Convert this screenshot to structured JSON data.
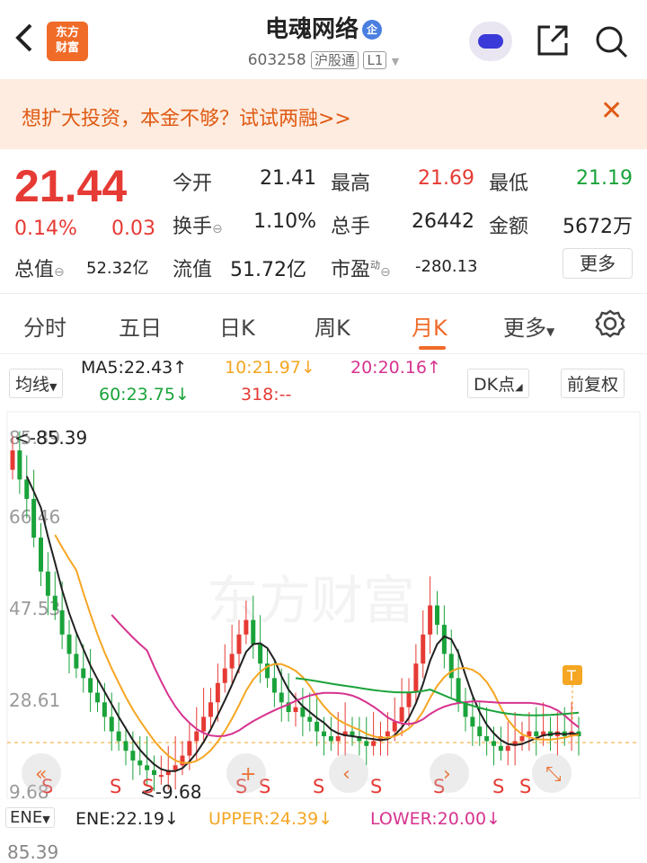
{
  "header": {
    "back_icon": "chevron-left-icon",
    "logo_text_line1": "东方",
    "logo_text_line2": "财富",
    "stock_name": "电魂网络",
    "badge": "企",
    "code": "603258",
    "market_tag": "沪股通",
    "level_tag": "L1"
  },
  "banner": {
    "text": "想扩大投资，本金不够？试试两融>>",
    "close": "✕"
  },
  "quote": {
    "price": "21.44",
    "change_pct": "0.14%",
    "change": "0.03",
    "open_label": "今开",
    "open": "21.41",
    "high_label": "最高",
    "high": "21.69",
    "low_label": "最低",
    "low": "21.19",
    "turnover_label": "换手",
    "turnover": "1.10%",
    "volume_label": "总手",
    "volume": "26442",
    "amount_label": "金额",
    "amount": "5672万",
    "mktcap_label": "总值",
    "mktcap": "52.32亿",
    "float_label": "流值",
    "float_cap": "51.72亿",
    "pe_label": "市盈",
    "pe_sup": "动",
    "pe": "-280.13",
    "more": "更多"
  },
  "tabs": [
    {
      "label": "分时"
    },
    {
      "label": "五日"
    },
    {
      "label": "日K"
    },
    {
      "label": "周K"
    },
    {
      "label": "月K"
    },
    {
      "label": "更多"
    }
  ],
  "ma": {
    "selector": "均线",
    "ma5": "MA5:22.43",
    "ma10": "10:21.97",
    "ma20": "20:20.16",
    "ma60": "60:23.75",
    "ma318": "318:--",
    "dk": "DK点",
    "adjust": "前复权"
  },
  "chart_data": {
    "type": "candlestick",
    "y_ticks": [
      "85.39",
      "66.46",
      "47.53",
      "28.61",
      "9.68"
    ],
    "max_label": "<-85.39",
    "min_label": "<-9.68",
    "watermark": "东方财富",
    "signal_letters": [
      "S",
      "S",
      "S",
      "S",
      "S",
      "S",
      "S",
      "S",
      "S",
      "S"
    ],
    "t_marker": "T",
    "ylim": [
      9.68,
      85.39
    ],
    "colors": {
      "up": "#e63a34",
      "down": "#1aa33a",
      "ma5": "#222222",
      "ma10": "#f5a623",
      "ma20": "#d6338f",
      "ma60": "#1aa33a"
    }
  },
  "indicator": {
    "selector": "ENE",
    "ene": "ENE:22.19",
    "upper": "UPPER:24.39",
    "lower": "LOWER:20.00",
    "top_tick": "85.39"
  }
}
